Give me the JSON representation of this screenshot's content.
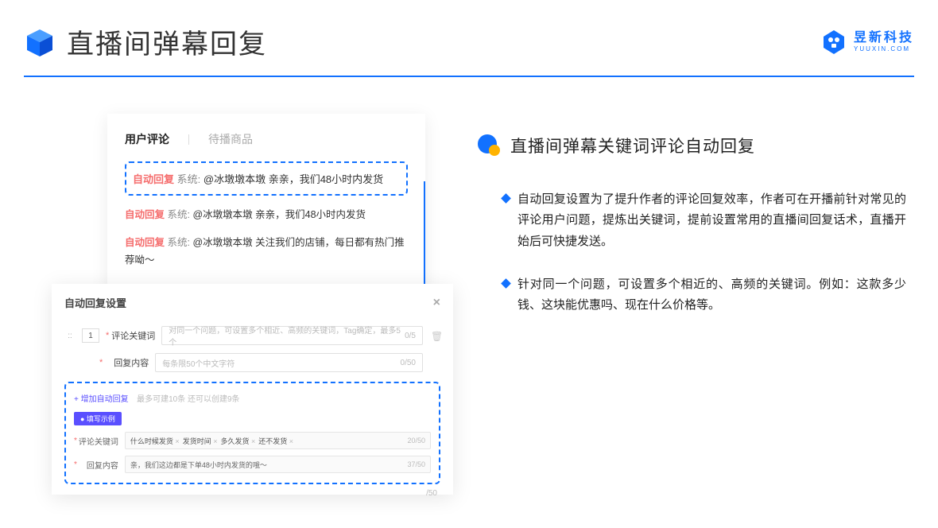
{
  "header": {
    "title": "直播间弹幕回复",
    "logo_cn": "昱新科技",
    "logo_en": "YUUXIN.COM"
  },
  "comment_card": {
    "tab_active": "用户评论",
    "tab_inactive": "待播商品",
    "auto_tag": "自动回复",
    "sys_label": "系统:",
    "row1": "@冰墩墩本墩 亲亲，我们48小时内发货",
    "row2": "@冰墩墩本墩 亲亲，我们48小时内发货",
    "row3": "@冰墩墩本墩 关注我们的店铺，每日都有热门推荐呦～"
  },
  "settings": {
    "title": "自动回复设置",
    "idx": "::",
    "num": "1",
    "label_kw": "评论关键词",
    "placeholder_kw": "对同一个问题，可设置多个相近、高频的关键词，Tag确定，最多5个",
    "count_kw": "0/5",
    "label_reply": "回复内容",
    "placeholder_reply": "每条限50个中文字符",
    "count_reply": "0/50",
    "add_link": "+ 增加自动回复",
    "add_sub": "最多可建10条 还可以创建9条",
    "badge": "● 填写示例",
    "ex_label_kw": "评论关键词",
    "ex_tags": [
      "什么时候发货",
      "发货时间",
      "多久发货",
      "还不发货"
    ],
    "ex_kw_count": "20/50",
    "ex_label_reply": "回复内容",
    "ex_reply": "亲，我们这边都是下单48小时内发货的哦～",
    "ex_reply_count": "37/50",
    "tail_count": "/50"
  },
  "right": {
    "title": "直播间弹幕关键词评论自动回复",
    "bullet1": "自动回复设置为了提升作者的评论回复效率，作者可在开播前针对常见的评论用户问题，提炼出关键词，提前设置常用的直播间回复话术，直播开始后可快捷发送。",
    "bullet2": "针对同一个问题，可设置多个相近的、高频的关键词。例如：这款多少钱、这块能优惠吗、现在什么价格等。"
  }
}
